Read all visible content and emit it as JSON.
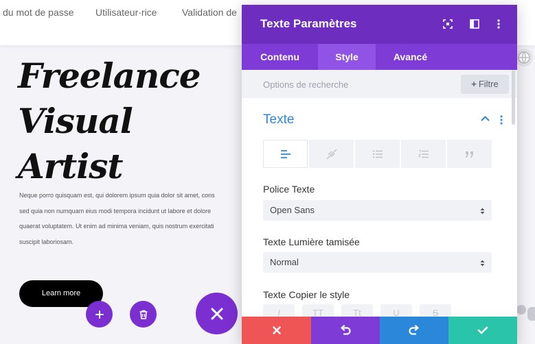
{
  "nav": {
    "links": [
      "du mot de passe",
      "Utilisateur·rice",
      "Validation de"
    ]
  },
  "page": {
    "hero_title_line1": "Freelance",
    "hero_title_line2": "Visual Artist",
    "body_lines": [
      "Neque porro quisquam est, qui dolorem ipsum quia dolor sit amet, cons",
      "sed quia non numquam eius modi tempora incidunt ut labore et dolore",
      "quaerat voluptatem. Ut enim ad minima veniam, quis nostrum exercitati",
      "suscipit laboriosam."
    ],
    "cta_label": "Learn more"
  },
  "panel": {
    "title": "Texte Paramètres",
    "tabs": [
      {
        "label": "Contenu",
        "active": false
      },
      {
        "label": "Style",
        "active": true
      },
      {
        "label": "Avancé",
        "active": false
      }
    ],
    "search_placeholder": "Options de recherche",
    "filter_label": "Filtre",
    "section_title": "Texte",
    "alignment_icons": [
      "align-left-icon",
      "no-align-icon",
      "bullet-list-icon",
      "numbered-list-icon",
      "quote-icon"
    ],
    "font_label": "Police Texte",
    "font_value": "Open Sans",
    "weight_label": "Texte Lumière tamisée",
    "weight_value": "Normal",
    "style_label": "Texte Copier le style",
    "style_buttons": [
      "I",
      "TT",
      "Tt",
      "U",
      "S"
    ],
    "actions": [
      {
        "name": "cancel",
        "icon": "close-icon",
        "color": "#ef5555"
      },
      {
        "name": "undo",
        "icon": "undo-icon",
        "color": "#7e3bd6"
      },
      {
        "name": "redo",
        "icon": "redo-icon",
        "color": "#2b87da"
      },
      {
        "name": "save",
        "icon": "check-icon",
        "color": "#29c4a9"
      }
    ]
  },
  "colors": {
    "header_purple": "#6d2ec0",
    "tab_purple": "#7e3bd6",
    "active_tab": "#9153e6",
    "accent_blue": "#2b87da",
    "fab_purple": "#7b2fd0"
  }
}
